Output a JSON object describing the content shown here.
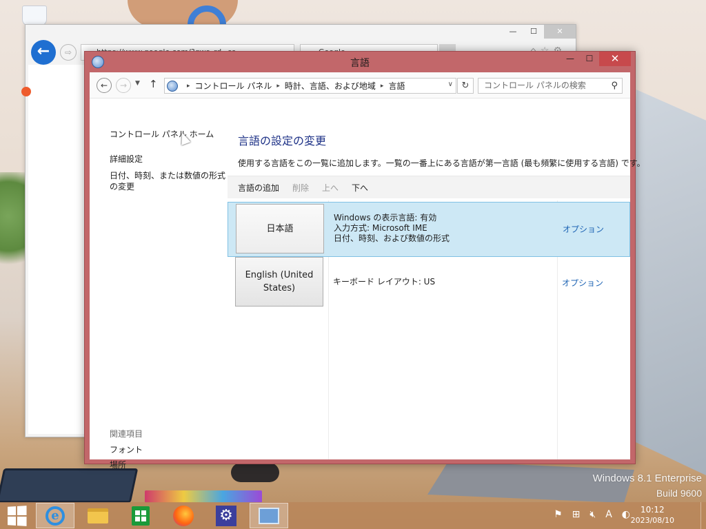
{
  "desktop": {
    "watermark_line1": "Windows 8.1 Enterprise",
    "watermark_line2": "Build 9600"
  },
  "browser": {
    "address": "https://www.google.com/?gws_rd=ss",
    "tab_title": "Google",
    "back_glyph": "←",
    "forward_glyph": "⇨",
    "minimize_glyph": "—",
    "maximize_glyph": "☐",
    "close_glyph": "✕"
  },
  "window": {
    "title": "言語",
    "minimize_glyph": "—",
    "maximize_glyph": "☐",
    "close_glyph": "✕"
  },
  "nav": {
    "back_glyph": "←",
    "forward_glyph": "→",
    "recent_glyph": "▼",
    "up_glyph": "↑",
    "breadcrumb": [
      "コントロール パネル",
      "時計、言語、および地域",
      "言語"
    ],
    "crumb_sep_glyph": "▸",
    "dropdown_glyph": "∨",
    "refresh_glyph": "↻",
    "search_placeholder": "コントロール パネルの検索",
    "search_glyph": "⚲"
  },
  "sidebar": {
    "home": "コントロール パネル ホーム",
    "advanced": "詳細設定",
    "date_format": "日付、時刻、または数値の形式の変更",
    "related_heading": "関連項目",
    "fonts": "フォント",
    "location": "場所"
  },
  "main": {
    "title": "言語の設定の変更",
    "description": "使用する言語をこの一覧に追加します。一覧の一番上にある言語が第一言語 (最も頻繁に使用する言語) です。",
    "toolbar": {
      "add": "言語の追加",
      "remove": "削除",
      "up": "上へ",
      "down": "下へ"
    },
    "languages": [
      {
        "name": "日本語",
        "details": [
          "Windows の表示言語: 有効",
          "入力方式: Microsoft IME",
          "日付、時刻、および数値の形式"
        ],
        "options": "オプション",
        "selected": true
      },
      {
        "name": "English (United States)",
        "details": [
          "キーボード レイアウト: US"
        ],
        "options": "オプション",
        "selected": false
      }
    ]
  },
  "taskbar": {
    "time": "10:12",
    "date": "2023/08/10",
    "ime_mode": "A",
    "tray_flag_glyph": "⚑",
    "tray_network_glyph": "⊞",
    "tray_volume_glyph": "🔇︎",
    "tray_ime_glyph": "◐",
    "settings_glyph": "⚙",
    "ie_glyph": "e"
  },
  "colors": {
    "window_frame": "#c2676a",
    "selection": "#cde8f5",
    "link": "#1e64b4",
    "title_text": "#1e3287"
  }
}
